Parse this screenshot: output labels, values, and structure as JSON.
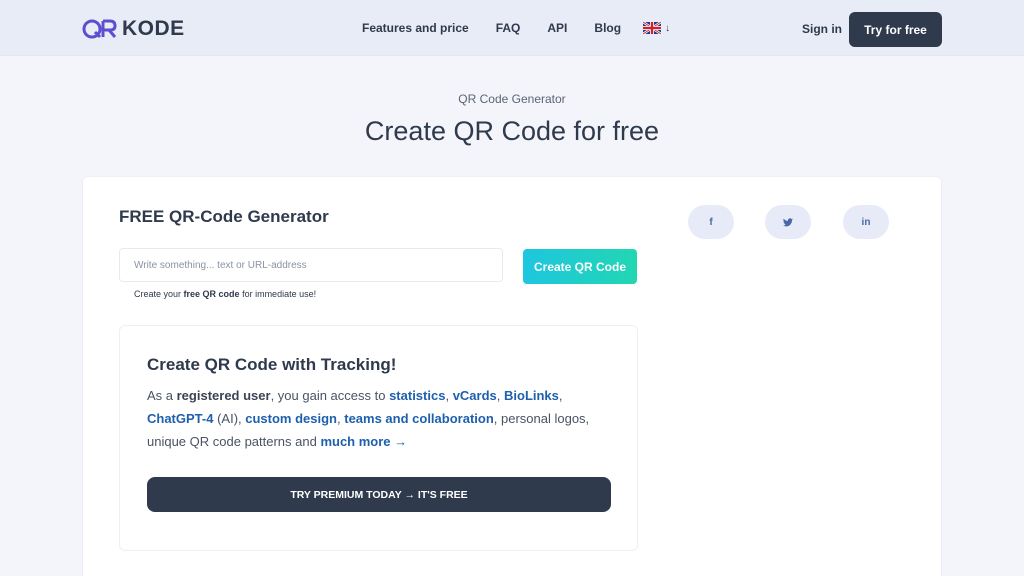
{
  "header": {
    "logo_text": "KODE",
    "nav": [
      "Features and price",
      "FAQ",
      "API",
      "Blog"
    ],
    "language_arrow": "↓",
    "signin_label": "Sign in",
    "try_label": "Try for free"
  },
  "hero": {
    "eyebrow": "QR Code Generator",
    "title": "Create QR Code for free"
  },
  "generator": {
    "title": "FREE QR-Code Generator",
    "input_placeholder": "Write something... text or URL-address",
    "button_label": "Create QR Code",
    "helper_pre": "Create your ",
    "helper_bold": "free QR code",
    "helper_post": " for immediate use!"
  },
  "social": {
    "facebook": "f",
    "twitter": "t",
    "linkedin": "in"
  },
  "premium": {
    "title": "Create QR Code with Tracking!",
    "text_as_a": "As a ",
    "text_registered_user": "registered user",
    "text_gain": ", you gain access to ",
    "link_statistics": "statistics",
    "sep1": ", ",
    "link_vcards": "vCards",
    "sep2": ", ",
    "link_biolinks": "BioLinks",
    "sep3": ",",
    "link_chatgpt": "ChatGPT-4",
    "text_ai": " (AI), ",
    "link_custom_design": "custom design",
    "sep4": ", ",
    "link_teams": "teams and collaboration",
    "text_logos": ", personal logos, unique QR code patterns and ",
    "link_more": "much more →",
    "button_label": "TRY PREMIUM TODAY → IT'S FREE"
  },
  "colors": {
    "primary_dark": "#2f3a4c",
    "accent_gradient_start": "#1ec6df",
    "accent_gradient_end": "#22d6b2",
    "link": "#1e5fae"
  }
}
